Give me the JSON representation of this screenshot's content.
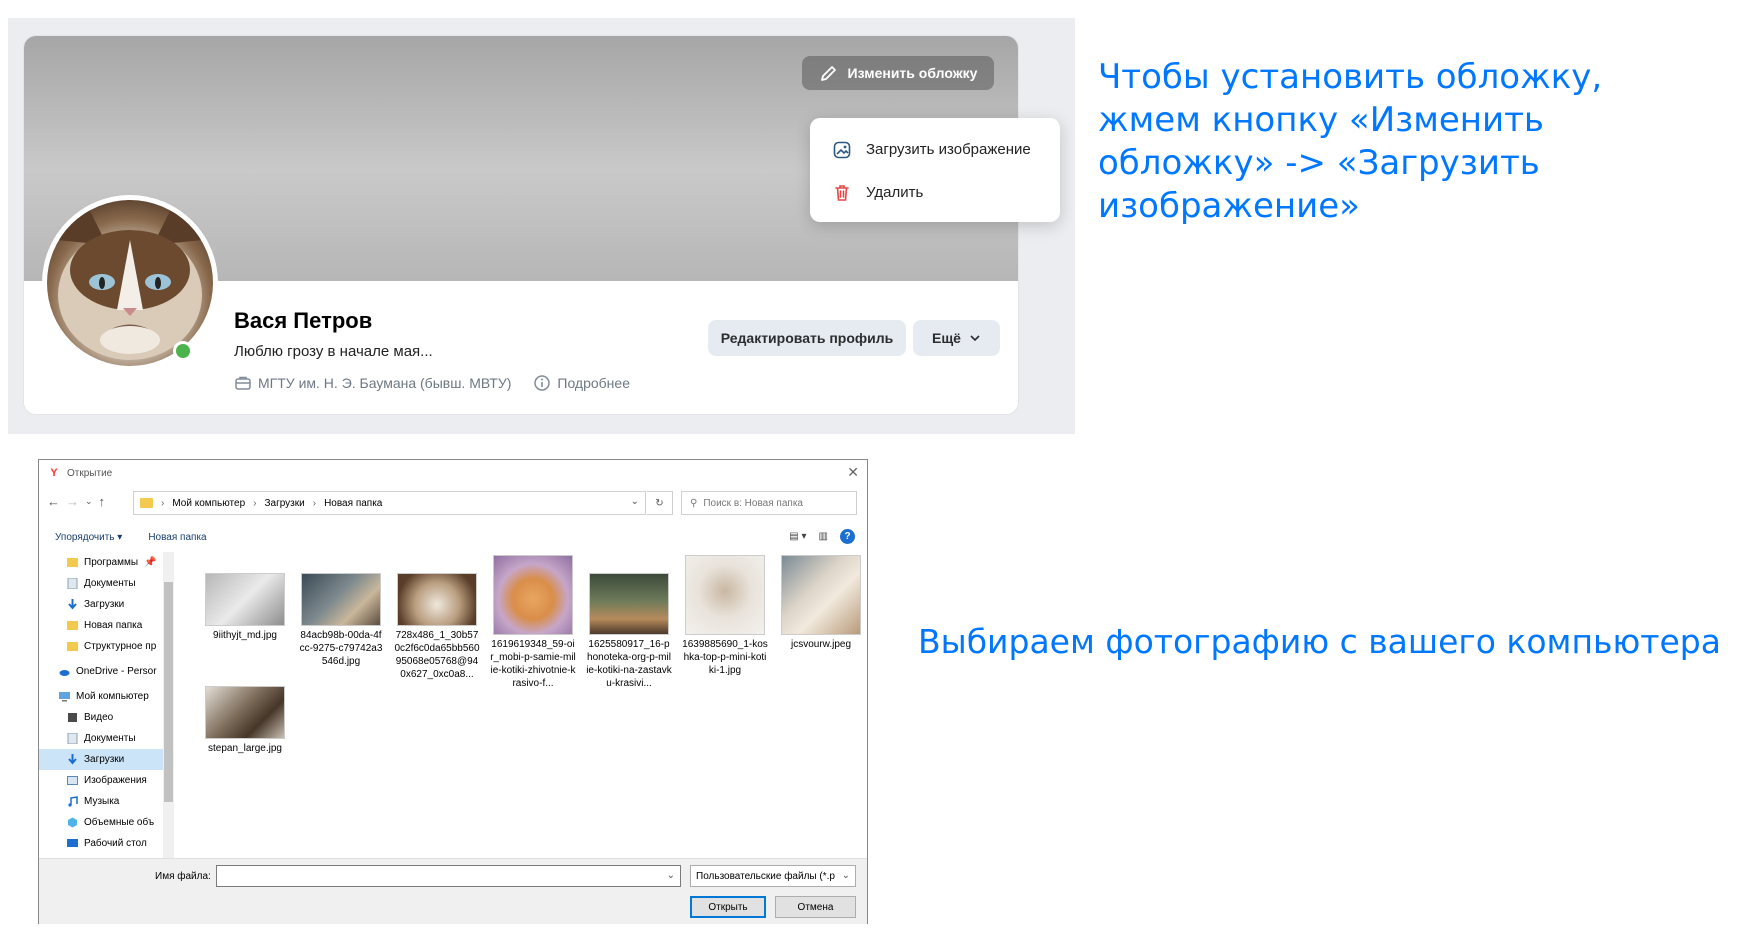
{
  "vk": {
    "change_cover_label": "Изменить обложку",
    "menu": {
      "upload_label": "Загрузить изображение",
      "delete_label": "Удалить"
    },
    "profile": {
      "name": "Вася Петров",
      "status": "Люблю грозу в начале мая...",
      "university": "МГТУ им. Н. Э. Баумана (бывш. МВТУ)",
      "more_info": "Подробнее",
      "edit_button": "Редактировать профиль",
      "more_button": "Ещё"
    },
    "colors": {
      "accent": "#0077ff",
      "online": "#4bb34b",
      "delete_icon": "#e64646"
    }
  },
  "captions": {
    "first": "Чтобы установить обложку, жмем кнопку «Изменить обложку» -> «Загрузить изображение»",
    "second": "Выбираем фотографию с вашего компьютера"
  },
  "dialog": {
    "title": "Открытие",
    "breadcrumb": [
      "Мой компьютер",
      "Загрузки",
      "Новая папка"
    ],
    "search_placeholder": "Поиск в: Новая папка",
    "toolbar": {
      "organize": "Упорядочить ▾",
      "new_folder": "Новая папка"
    },
    "nav": [
      {
        "label": "Программы",
        "icon": "folder-icon"
      },
      {
        "label": "Документы",
        "icon": "documents-icon"
      },
      {
        "label": "Загрузки",
        "icon": "download-icon"
      },
      {
        "label": "Новая папка",
        "icon": "folder-icon"
      },
      {
        "label": "Структурное пр",
        "icon": "folder-icon"
      },
      {
        "label": "OneDrive - Persor",
        "icon": "cloud-icon"
      },
      {
        "label": "Мой компьютер",
        "icon": "computer-icon"
      },
      {
        "label": "Видео",
        "icon": "video-icon"
      },
      {
        "label": "Документы",
        "icon": "documents-icon"
      },
      {
        "label": "Загрузки",
        "icon": "download-icon"
      },
      {
        "label": "Изображения",
        "icon": "images-icon"
      },
      {
        "label": "Музыка",
        "icon": "music-icon"
      },
      {
        "label": "Объемные объ",
        "icon": "3d-objects-icon"
      },
      {
        "label": "Рабочий стол",
        "icon": "desktop-icon"
      }
    ],
    "files": [
      "9iithyjt_md.jpg",
      "84acb98b-00da-4fcc-9275-c79742a3546d.jpg",
      "728x486_1_30b570c2f6c0da65bb56095068e05768@940x627_0xc0a8...",
      "1619619348_59-oir_mobi-p-samie-milie-kotiki-zhivotnie-krasivo-f...",
      "1625580917_16-phonoteka-org-p-milie-kotiki-na-zastavku-krasivi...",
      "1639885690_1-koshka-top-p-mini-kotiki-1.jpg",
      "jcsvourw.jpeg",
      "stepan_large.jpg"
    ],
    "filename_label": "Имя файла:",
    "filename_value": "",
    "filetype": "Пользовательские файлы (*.p",
    "open_button": "Открыть",
    "cancel_button": "Отмена"
  }
}
